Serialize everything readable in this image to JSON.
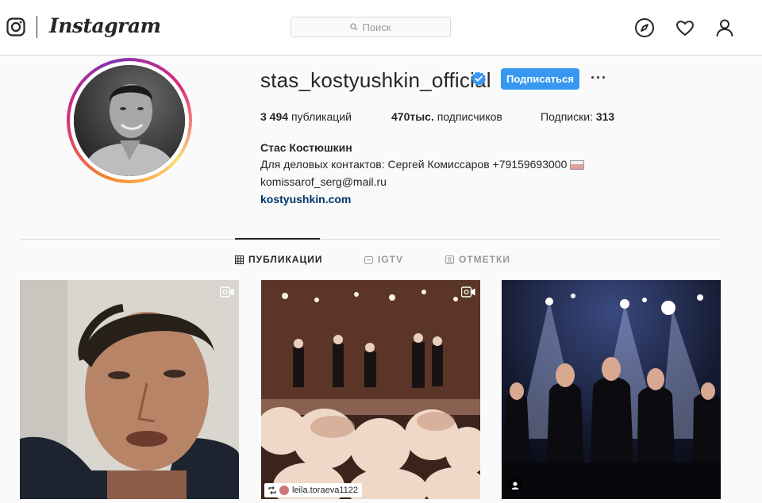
{
  "nav": {
    "brand": "Instagram",
    "search_placeholder": "Поиск",
    "icons": [
      "instagram-glyph-icon",
      "compass-icon",
      "heart-icon",
      "person-icon"
    ]
  },
  "profile": {
    "username": "stas_kostyushkin_official",
    "verified": true,
    "follow_label": "Подписаться",
    "more_label": "···",
    "stats": {
      "posts_count": "3 494",
      "posts_label": "публикаций",
      "followers_count": "470тыс.",
      "followers_label": "подписчиков",
      "following_label": "Подписки:",
      "following_count": "313"
    },
    "full_name": "Стас Костюшкин",
    "bio_line1": "Для деловых контактов: Сергей Комиссаров +79159693000",
    "bio_line2": "komissarof_serg@mail.ru",
    "website": "kostyushkin.com"
  },
  "tabs": [
    {
      "label": "ПУБЛИКАЦИИ",
      "icon": "grid-icon",
      "active": true
    },
    {
      "label": "IGTV",
      "icon": "igtv-icon",
      "active": false
    },
    {
      "label": "ОТМЕТКИ",
      "icon": "tagged-icon",
      "active": false
    }
  ],
  "posts": [
    {
      "type": "video",
      "icon": "video-icon"
    },
    {
      "type": "video",
      "icon": "video-icon",
      "repost_user": "leila.toraeva1122"
    },
    {
      "type": "photo",
      "icon": "user-tag-icon"
    }
  ],
  "colors": {
    "accent": "#3897f0",
    "link": "#003569",
    "border": "#dbdbdb",
    "background": "#fafafa"
  }
}
